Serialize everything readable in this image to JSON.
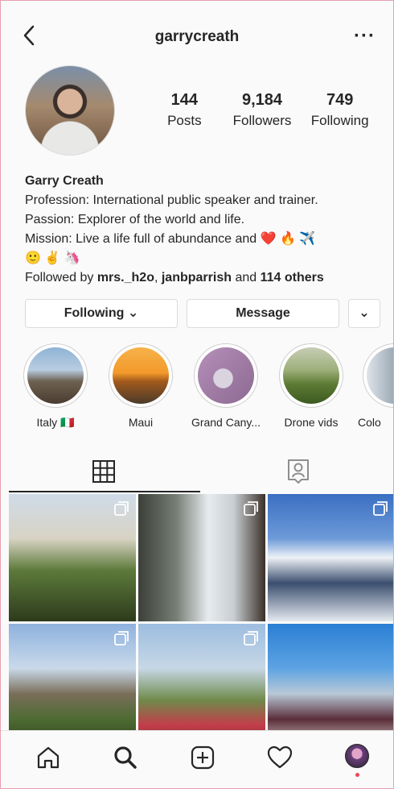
{
  "header": {
    "username": "garrycreath"
  },
  "profile": {
    "stats": [
      {
        "value": "144",
        "label": "Posts"
      },
      {
        "value": "9,184",
        "label": "Followers"
      },
      {
        "value": "749",
        "label": "Following"
      }
    ],
    "name": "Garry Creath",
    "bio_lines": [
      "Profession: International public speaker and trainer.",
      "Passion: Explorer of the world and life.",
      "Mission: Live a life full of abundance and ❤️ 🔥 ✈️",
      "🙂 ✌️ 🦄"
    ],
    "followed_by": {
      "prefix": "Followed by ",
      "user1": "mrs._h2o",
      "sep": ", ",
      "user2": "janbparrish",
      "and": " and ",
      "others": "114 others"
    }
  },
  "buttons": {
    "following": "Following ⌄",
    "message": "Message",
    "dropdown": "⌄"
  },
  "highlights": [
    {
      "label": "Italy 🇮🇹"
    },
    {
      "label": "Maui"
    },
    {
      "label": "Grand Cany..."
    },
    {
      "label": "Drone vids"
    },
    {
      "label": "Colo"
    }
  ],
  "tabs": {
    "active": "grid"
  },
  "icons": {
    "back": "chevron-left-icon",
    "more": "more-horizontal-icon",
    "grid": "grid-icon",
    "tagged": "tagged-person-icon",
    "home": "home-icon",
    "search": "search-icon",
    "add": "add-post-icon",
    "activity": "heart-icon",
    "profile": "profile-avatar-icon"
  },
  "colors": {
    "text": "#262626",
    "border": "#dbdbdb",
    "heart": "#e0245e",
    "notification_dot": "#ed4956"
  }
}
